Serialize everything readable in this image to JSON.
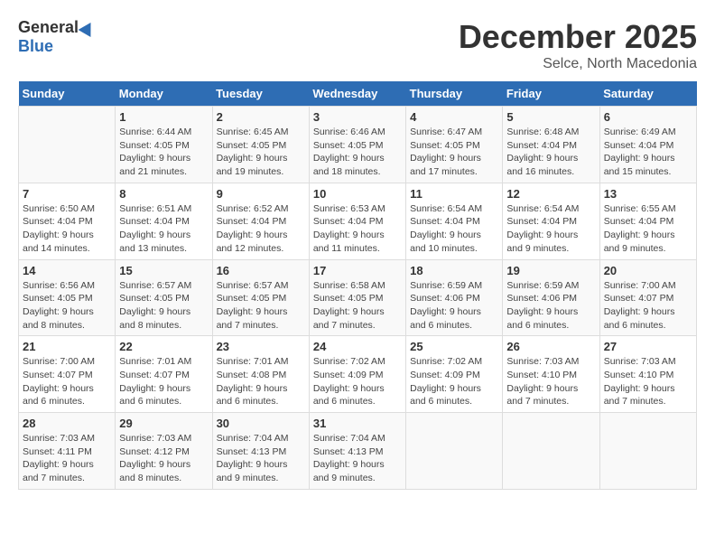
{
  "header": {
    "logo_general": "General",
    "logo_blue": "Blue",
    "title": "December 2025",
    "location": "Selce, North Macedonia"
  },
  "days_of_week": [
    "Sunday",
    "Monday",
    "Tuesday",
    "Wednesday",
    "Thursday",
    "Friday",
    "Saturday"
  ],
  "weeks": [
    [
      {
        "day": "",
        "info": ""
      },
      {
        "day": "1",
        "info": "Sunrise: 6:44 AM\nSunset: 4:05 PM\nDaylight: 9 hours\nand 21 minutes."
      },
      {
        "day": "2",
        "info": "Sunrise: 6:45 AM\nSunset: 4:05 PM\nDaylight: 9 hours\nand 19 minutes."
      },
      {
        "day": "3",
        "info": "Sunrise: 6:46 AM\nSunset: 4:05 PM\nDaylight: 9 hours\nand 18 minutes."
      },
      {
        "day": "4",
        "info": "Sunrise: 6:47 AM\nSunset: 4:05 PM\nDaylight: 9 hours\nand 17 minutes."
      },
      {
        "day": "5",
        "info": "Sunrise: 6:48 AM\nSunset: 4:04 PM\nDaylight: 9 hours\nand 16 minutes."
      },
      {
        "day": "6",
        "info": "Sunrise: 6:49 AM\nSunset: 4:04 PM\nDaylight: 9 hours\nand 15 minutes."
      }
    ],
    [
      {
        "day": "7",
        "info": "Sunrise: 6:50 AM\nSunset: 4:04 PM\nDaylight: 9 hours\nand 14 minutes."
      },
      {
        "day": "8",
        "info": "Sunrise: 6:51 AM\nSunset: 4:04 PM\nDaylight: 9 hours\nand 13 minutes."
      },
      {
        "day": "9",
        "info": "Sunrise: 6:52 AM\nSunset: 4:04 PM\nDaylight: 9 hours\nand 12 minutes."
      },
      {
        "day": "10",
        "info": "Sunrise: 6:53 AM\nSunset: 4:04 PM\nDaylight: 9 hours\nand 11 minutes."
      },
      {
        "day": "11",
        "info": "Sunrise: 6:54 AM\nSunset: 4:04 PM\nDaylight: 9 hours\nand 10 minutes."
      },
      {
        "day": "12",
        "info": "Sunrise: 6:54 AM\nSunset: 4:04 PM\nDaylight: 9 hours\nand 9 minutes."
      },
      {
        "day": "13",
        "info": "Sunrise: 6:55 AM\nSunset: 4:04 PM\nDaylight: 9 hours\nand 9 minutes."
      }
    ],
    [
      {
        "day": "14",
        "info": "Sunrise: 6:56 AM\nSunset: 4:05 PM\nDaylight: 9 hours\nand 8 minutes."
      },
      {
        "day": "15",
        "info": "Sunrise: 6:57 AM\nSunset: 4:05 PM\nDaylight: 9 hours\nand 8 minutes."
      },
      {
        "day": "16",
        "info": "Sunrise: 6:57 AM\nSunset: 4:05 PM\nDaylight: 9 hours\nand 7 minutes."
      },
      {
        "day": "17",
        "info": "Sunrise: 6:58 AM\nSunset: 4:05 PM\nDaylight: 9 hours\nand 7 minutes."
      },
      {
        "day": "18",
        "info": "Sunrise: 6:59 AM\nSunset: 4:06 PM\nDaylight: 9 hours\nand 6 minutes."
      },
      {
        "day": "19",
        "info": "Sunrise: 6:59 AM\nSunset: 4:06 PM\nDaylight: 9 hours\nand 6 minutes."
      },
      {
        "day": "20",
        "info": "Sunrise: 7:00 AM\nSunset: 4:07 PM\nDaylight: 9 hours\nand 6 minutes."
      }
    ],
    [
      {
        "day": "21",
        "info": "Sunrise: 7:00 AM\nSunset: 4:07 PM\nDaylight: 9 hours\nand 6 minutes."
      },
      {
        "day": "22",
        "info": "Sunrise: 7:01 AM\nSunset: 4:07 PM\nDaylight: 9 hours\nand 6 minutes."
      },
      {
        "day": "23",
        "info": "Sunrise: 7:01 AM\nSunset: 4:08 PM\nDaylight: 9 hours\nand 6 minutes."
      },
      {
        "day": "24",
        "info": "Sunrise: 7:02 AM\nSunset: 4:09 PM\nDaylight: 9 hours\nand 6 minutes."
      },
      {
        "day": "25",
        "info": "Sunrise: 7:02 AM\nSunset: 4:09 PM\nDaylight: 9 hours\nand 6 minutes."
      },
      {
        "day": "26",
        "info": "Sunrise: 7:03 AM\nSunset: 4:10 PM\nDaylight: 9 hours\nand 7 minutes."
      },
      {
        "day": "27",
        "info": "Sunrise: 7:03 AM\nSunset: 4:10 PM\nDaylight: 9 hours\nand 7 minutes."
      }
    ],
    [
      {
        "day": "28",
        "info": "Sunrise: 7:03 AM\nSunset: 4:11 PM\nDaylight: 9 hours\nand 7 minutes."
      },
      {
        "day": "29",
        "info": "Sunrise: 7:03 AM\nSunset: 4:12 PM\nDaylight: 9 hours\nand 8 minutes."
      },
      {
        "day": "30",
        "info": "Sunrise: 7:04 AM\nSunset: 4:13 PM\nDaylight: 9 hours\nand 9 minutes."
      },
      {
        "day": "31",
        "info": "Sunrise: 7:04 AM\nSunset: 4:13 PM\nDaylight: 9 hours\nand 9 minutes."
      },
      {
        "day": "",
        "info": ""
      },
      {
        "day": "",
        "info": ""
      },
      {
        "day": "",
        "info": ""
      }
    ]
  ]
}
